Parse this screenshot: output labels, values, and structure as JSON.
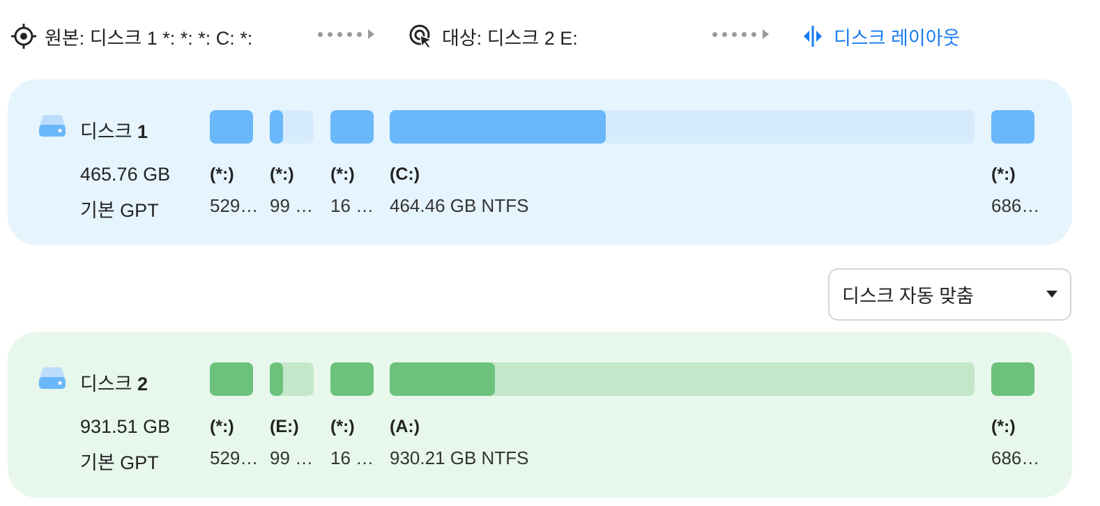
{
  "toolbar": {
    "source_label": "원본:",
    "source_value": "디스크 1 *: *: *: C: *:",
    "target_label": "대상:",
    "target_value": "디스크 2 E:",
    "layout_label": "디스크 레이아웃"
  },
  "source_disk": {
    "name_prefix": "디스크",
    "number": "1",
    "size": "465.76 GB",
    "type": "기본 GPT",
    "partitions": [
      {
        "label": "(*:)",
        "detail": "529…",
        "fill": 1.0
      },
      {
        "label": "(*:)",
        "detail": "99 …",
        "fill": 0.3
      },
      {
        "label": "(*:)",
        "detail": "16 …",
        "fill": 1.0
      },
      {
        "label": "(C:)",
        "detail": "464.46 GB NTFS",
        "fill": 0.37
      },
      {
        "label": "(*:)",
        "detail": "686…",
        "fill": 1.0
      }
    ]
  },
  "target_disk": {
    "name_prefix": "디스크",
    "number": "2",
    "size": "931.51 GB",
    "type": "기본 GPT",
    "partitions": [
      {
        "label": "(*:)",
        "detail": "529…",
        "fill": 1.0
      },
      {
        "label": "(E:)",
        "detail": "99 …",
        "fill": 0.3
      },
      {
        "label": "(*:)",
        "detail": "16 …",
        "fill": 1.0
      },
      {
        "label": "(A:)",
        "detail": "930.21 GB NTFS",
        "fill": 0.18
      },
      {
        "label": "(*:)",
        "detail": "686…",
        "fill": 1.0
      }
    ]
  },
  "fit_dropdown": {
    "selected": "디스크 자동 맞춤"
  },
  "colors": {
    "source_bg": "#e6f4fe",
    "source_used": "#6ab7fb",
    "source_free": "#d6ecfc",
    "target_bg": "#e7f7ec",
    "target_used": "#6cc27a",
    "target_free": "#c3e7c9",
    "accent": "#1a7bf2"
  },
  "icons": {
    "source": "crosshair-icon",
    "target": "target-cursor-icon",
    "layout": "split-layout-icon",
    "disk": "hard-disk-icon"
  }
}
